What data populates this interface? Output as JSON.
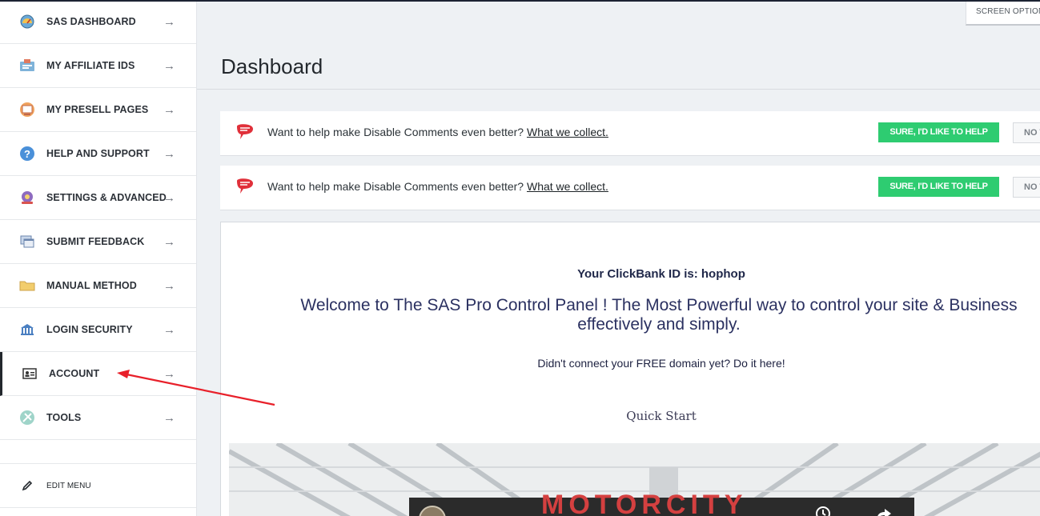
{
  "sidebar": {
    "items": [
      {
        "label": "SAS DASHBOARD",
        "icon": "dashboard-gauge-icon"
      },
      {
        "label": "MY AFFILIATE IDS",
        "icon": "id-card-icon"
      },
      {
        "label": "MY PRESELL PAGES",
        "icon": "presell-page-icon"
      },
      {
        "label": "HELP AND SUPPORT",
        "icon": "help-question-icon"
      },
      {
        "label": "SETTINGS & ADVANCED",
        "icon": "settings-icon"
      },
      {
        "label": "SUBMIT FEEDBACK",
        "icon": "feedback-window-icon"
      },
      {
        "label": "MANUAL METHOD",
        "icon": "folder-icon"
      },
      {
        "label": "LOGIN SECURITY",
        "icon": "bank-security-icon"
      },
      {
        "label": "ACCOUNT",
        "icon": "account-card-icon"
      },
      {
        "label": "TOOLS",
        "icon": "tools-icon"
      }
    ],
    "edit_menu": {
      "label": "EDIT MENU",
      "icon": "pencil-icon"
    },
    "arrow_glyph": "→"
  },
  "screen_options": {
    "label": "SCREEN OPTIONS"
  },
  "page": {
    "title": "Dashboard"
  },
  "notices": [
    {
      "text": "Want to help make Disable Comments even better?",
      "link": "What we collect.",
      "yes": "SURE, I'D LIKE TO HELP",
      "no": "NO THANKS"
    },
    {
      "text": "Want to help make Disable Comments even better?",
      "link": "What we collect.",
      "yes": "SURE, I'D LIKE TO HELP",
      "no": "NO THANKS"
    }
  ],
  "panel": {
    "clickbank_id": "Your ClickBank ID is: hophop",
    "welcome": "Welcome to The SAS Pro Control Panel !  The Most Powerful way to control your site & Business effectively and simply.",
    "domain_prompt": "Didn't connect your FREE domain yet? Do it here!",
    "quick_start": "Quick Start",
    "video_brand": "MOTORCITY"
  },
  "colors": {
    "accent_green": "#2ecc71",
    "annotation_red": "#e8202a",
    "sidebar_text": "#2c3138",
    "welcome_text": "#2b3161"
  }
}
